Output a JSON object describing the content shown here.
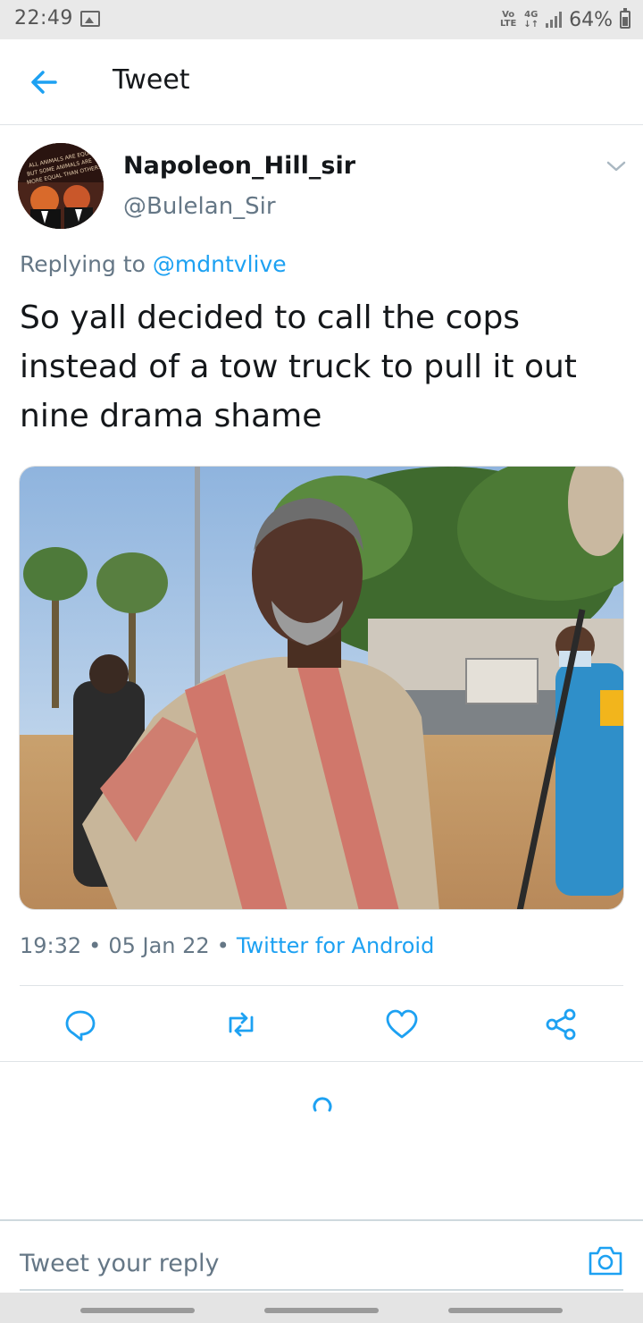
{
  "status_bar": {
    "time": "22:49",
    "volte_top": "Vo",
    "volte_bottom": "LTE",
    "network": "4G",
    "network_arrows": "↓↑",
    "battery_percent": "64%",
    "battery_level": 0.64
  },
  "header": {
    "title": "Tweet"
  },
  "tweet": {
    "author_name": "Napoleon_Hill_sir",
    "author_handle": "@Bulelan_Sir",
    "replying_prefix": "Replying to",
    "replying_to": "@mdntvlive",
    "text": "So yall decided to call the cops instead of a tow truck to pull it out nine drama shame",
    "time": "19:32",
    "date": "05 Jan 22",
    "source": "Twitter for Android",
    "separator": "•"
  },
  "avatar_banner": [
    "ALL ANIMALS ARE EQUAL",
    "BUT SOME ANIMALS ARE",
    "MORE EQUAL THAN OTHERS"
  ],
  "actions": {
    "reply_icon": "reply-icon",
    "retweet_icon": "retweet-icon",
    "like_icon": "heart-icon",
    "share_icon": "share-icon"
  },
  "reply_bar": {
    "placeholder": "Tweet your reply"
  },
  "colors": {
    "accent": "#1da1f2",
    "secondary_text": "#657786",
    "primary_text": "#14171a"
  }
}
